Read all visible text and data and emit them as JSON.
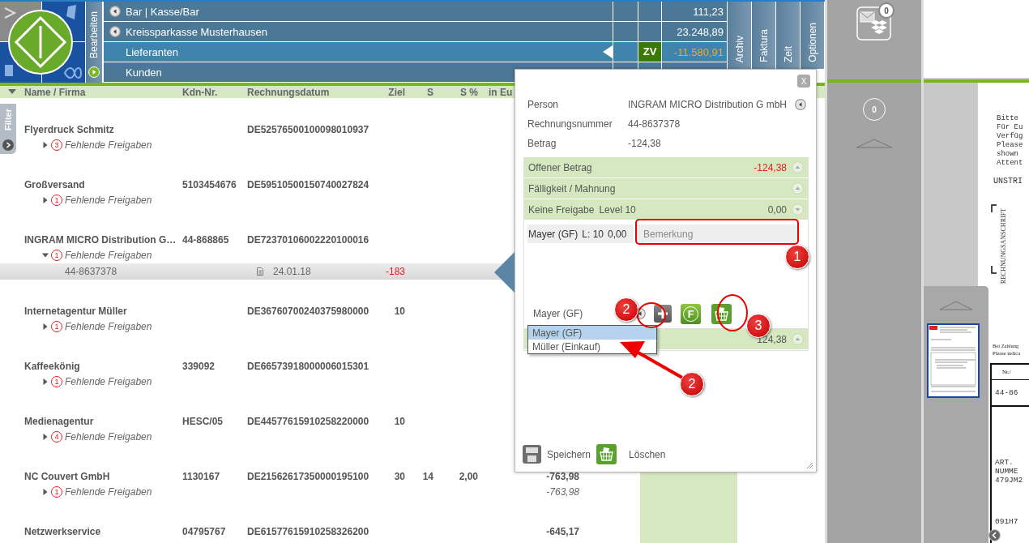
{
  "edit_tab": "Bearbeiten",
  "accounts": [
    {
      "kind": "account",
      "label": "Bar | Kasse/Bar",
      "selected": false,
      "amount": "111,23",
      "alert": false
    },
    {
      "kind": "account",
      "label": "Kreissparkasse Musterhausen",
      "selected": false,
      "amount": "23.248,89",
      "alert": false
    },
    {
      "kind": "group",
      "label": "Lieferanten",
      "selected": true,
      "badge": "ZV",
      "amount": "-11.580,91",
      "alert": true
    },
    {
      "kind": "group",
      "label": "Kunden",
      "selected": false
    }
  ],
  "side_tabs": [
    "Archiv",
    "Faktura",
    "Zeit",
    "Optionen"
  ],
  "mailbox": {
    "badge": "0"
  },
  "table": {
    "columns": [
      "Name / Firma",
      "Kdn-Nr.",
      "Rechnungsdatum",
      "Ziel",
      "S",
      "S %",
      "in Eu"
    ],
    "groups": [
      {
        "name": "Flyerdruck Schmitz",
        "reference": "DE52576500100098010937",
        "pending": {
          "count": "3",
          "label": "Fehlende Freigaben",
          "expanded": false
        }
      },
      {
        "name": "Großversand",
        "customer_no": "5103454676",
        "reference": "DE59510500150740027824",
        "pending": {
          "count": "1",
          "label": "Fehlende Freigaben",
          "expanded": false
        }
      },
      {
        "name": "INGRAM MICRO Distribution G…",
        "customer_no": "44-868865",
        "reference": "DE72370106002220100016",
        "pending": {
          "count": "1",
          "label": "Fehlende Freigaben",
          "expanded": true
        },
        "invoices": [
          {
            "number": "44-8637378",
            "date": "24.01.18",
            "ziel": "-183",
            "alert": true
          }
        ]
      },
      {
        "name": "Internetagentur Müller",
        "reference": "DE36760700240375980000",
        "ziel": "10",
        "pending": {
          "count": "1",
          "label": "Fehlende Freigaben",
          "expanded": false
        }
      },
      {
        "name": "Kaffeekönig",
        "customer_no": "339092",
        "reference": "DE66573918000006015301",
        "pending": {
          "count": "1",
          "label": "Fehlende Freigaben",
          "expanded": false
        }
      },
      {
        "name": "Medienagentur",
        "customer_no": "HESC/05",
        "reference": "DE44577615910258220000",
        "ziel": "10",
        "pending": {
          "count": "4",
          "label": "Fehlende Freigaben",
          "expanded": false
        }
      },
      {
        "name": "NC Couvert GmbH",
        "customer_no": "1130167",
        "reference": "DE21562617350000195100",
        "ziel": "30",
        "s": "14",
        "s_pct": "2,00",
        "amount": "-763,98",
        "pending": {
          "count": "1",
          "label": "Fehlende Freigaben",
          "expanded": false,
          "amount": "-763,98"
        }
      },
      {
        "name": "Netzwerkservice",
        "customer_no": "04795767",
        "reference": "DE61577615910258326200",
        "amount": "-645,17"
      }
    ]
  },
  "filter_tab": "Filter",
  "popup": {
    "close": "X",
    "fields": [
      {
        "kind": "select",
        "label": "Person",
        "value": "INGRAM MICRO Distribution G mbH"
      },
      {
        "kind": "text",
        "label": "Rechnungsnummer",
        "value": "44-8637378"
      },
      {
        "kind": "text",
        "label": "Betrag",
        "value": "-124,38"
      }
    ],
    "sections": [
      {
        "title": "Offener Betrag",
        "value": "-124,38",
        "alert": true,
        "expanded": false
      },
      {
        "title": "Fälligkeit / Mahnung",
        "expanded": false
      },
      {
        "title": "Keine Freigabe",
        "subtitle": "Level 10",
        "value": "0,00",
        "alert": false,
        "expanded": true
      },
      {
        "value": "124,38",
        "alert": false,
        "expanded": false
      }
    ],
    "approval": {
      "approver": "Mayer (GF)",
      "level": "L: 10",
      "amount": "0,00",
      "remark_placeholder": "Bemerkung"
    },
    "approver_select": {
      "value": "Mayer (GF)",
      "f_label": "F",
      "options": [
        {
          "label": "Mayer (GF)",
          "selected": true
        },
        {
          "label": "Müller (Einkauf)",
          "selected": false
        }
      ]
    },
    "actions": [
      {
        "kind": "save",
        "label": "Speichern"
      },
      {
        "kind": "delete",
        "label": "Löschen"
      }
    ]
  },
  "queue_panel": {
    "counter": "0"
  },
  "document": {
    "lines": [
      "Bitte",
      "Für Eu",
      "Verfüg",
      "Please",
      "shown",
      "Attent"
    ],
    "heading": "UNSTRI",
    "address_label": "RECHNUNGSANSCHRIFT",
    "payment_note": [
      "Bei Zahlung",
      "Please indica"
    ],
    "table_header": "Nr./",
    "invoice_no": "44-86",
    "item_lines": [
      "ART.",
      "NUMME",
      "479JM2"
    ],
    "item_code": "091H7"
  },
  "annotations": [
    "1",
    "2",
    "3",
    "2"
  ]
}
